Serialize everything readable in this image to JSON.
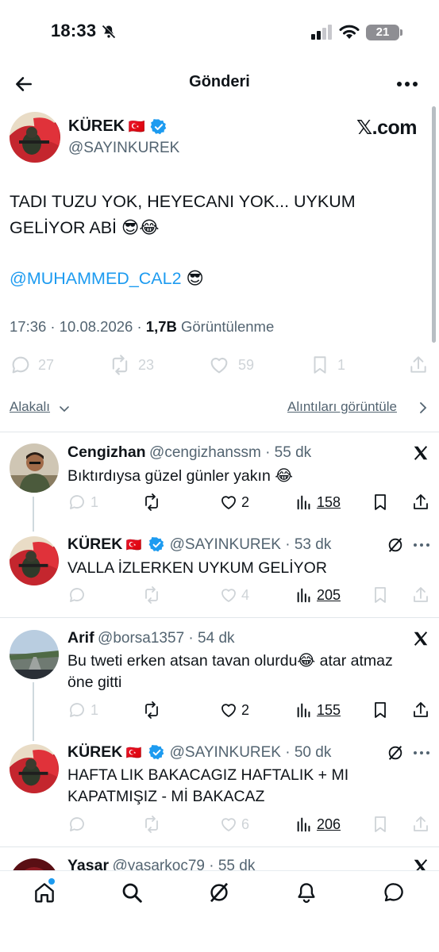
{
  "status_bar": {
    "time": "18:33",
    "battery": "21"
  },
  "header": {
    "title": "Gönderi"
  },
  "post": {
    "author": "KÜREK",
    "flag": "🇹🇷",
    "handle": "@SAYINKUREK",
    "source": "𝕏.com",
    "text_line1": "TADI TUZU YOK, HEYECANI YOK... UYKUM",
    "text_line2": "GELİYOR ABİ 😎😂",
    "mention": "@MUHAMMED_CAL2",
    "mention_emoji": "😎",
    "time": "17:36 · 10.08.2026 · ",
    "views": "1,7B",
    "views_label": " Görüntülenme",
    "stats": {
      "replies": "27",
      "reposts": "23",
      "likes": "59",
      "bookmarks": "1"
    }
  },
  "sort": {
    "relevance": "Alakalı",
    "quotes": "Alıntıları görüntüle"
  },
  "replies": [
    {
      "name": "Cengizhan",
      "handle": "@cengizhanssm",
      "age": " · 55 dk",
      "text": "Bıktırdıysa güzel günler yakın 😂",
      "replies": "1",
      "reposts": "",
      "likes": "2",
      "views": "158"
    },
    {
      "name": "KÜREK",
      "flag": "🇹🇷",
      "handle": "@SAYINKUREK",
      "age": " · 53 dk",
      "text": "VALLA İZLERKEN UYKUM GELİYOR",
      "replies": "",
      "reposts": "",
      "likes": "4",
      "views": "205"
    },
    {
      "name": "Arif",
      "handle": "@borsa1357",
      "age": " · 54 dk",
      "text_line1": "Bu tweti erken atsan tavan olurdu😂 atar atmaz",
      "text_line2": "öne gitti",
      "replies": "1",
      "reposts": "",
      "likes": "2",
      "views": "155"
    },
    {
      "name": "KÜREK",
      "flag": "🇹🇷",
      "handle": "@SAYINKUREK",
      "age": " · 50 dk",
      "text_line1": "HAFTA LIK BAKACAGIZ HAFTALIK + MI",
      "text_line2": "KAPATMIŞIZ - Mİ BAKACAZ",
      "replies": "",
      "reposts": "",
      "likes": "6",
      "views": "206"
    },
    {
      "name": "Yasar",
      "handle": "@yasarkoc79",
      "age": " · 55 dk"
    }
  ],
  "icons": [
    "back-arrow-icon",
    "more-icon",
    "verified-icon",
    "reply-icon",
    "repost-icon",
    "like-icon",
    "bookmark-icon",
    "share-icon",
    "views-icon",
    "grok-icon",
    "x-logo-icon",
    "home-icon",
    "search-icon",
    "bell-icon",
    "chat-icon"
  ],
  "colors": {
    "accent": "#1d9bf0",
    "muted": "#536471",
    "text": "#0f1419"
  }
}
